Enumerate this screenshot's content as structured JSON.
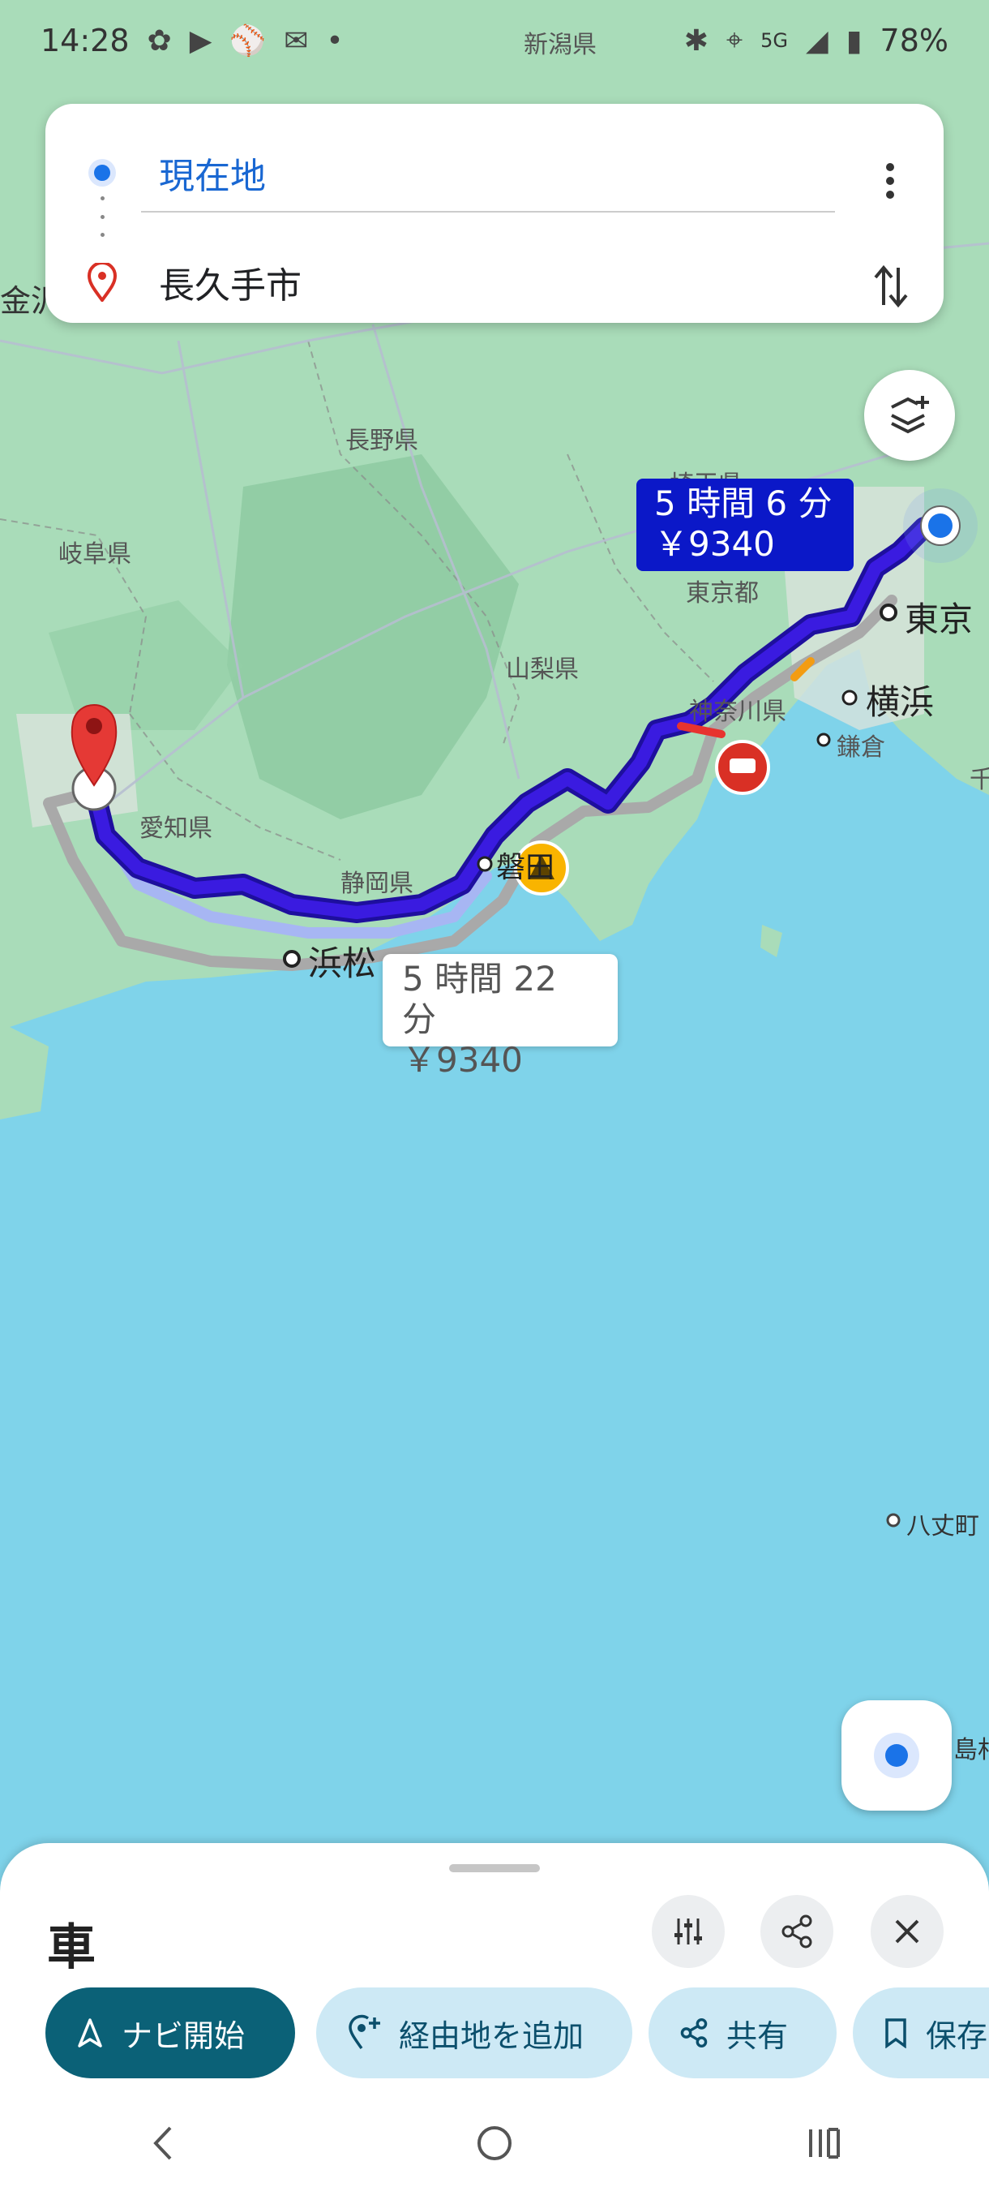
{
  "status_bar": {
    "time": "14:28",
    "network": "5G",
    "battery": "78%"
  },
  "search": {
    "origin": "現在地",
    "destination": "長久手市"
  },
  "map": {
    "route_main": {
      "duration": "5 時間 6 分",
      "toll": "￥9340"
    },
    "route_alt": {
      "duration": "5 時間 22 分",
      "toll": "￥9340"
    },
    "places": {
      "niigata": "新潟県",
      "kanazawa": "金沢",
      "nagano": "長野県",
      "gifu": "岐阜県",
      "saitama": "埼玉県",
      "tokyo_to": "東京都",
      "tokyo": "東京",
      "yamanashi": "山梨県",
      "kanagawa": "神奈川県",
      "yokohama": "横浜",
      "kamakura": "鎌倉",
      "chiba": "千",
      "aichi": "愛知県",
      "shizuoka": "静岡県",
      "hamamatsu": "浜松",
      "iwata": "磐田",
      "hachijo": "八丈町",
      "island": "島村"
    }
  },
  "sheet": {
    "mode": "車",
    "chips": {
      "start": "ナビ開始",
      "add_stop": "経由地を追加",
      "share": "共有",
      "save": "保存"
    }
  },
  "colors": {
    "route_primary": "#3a1be0",
    "route_alt": "#a9a9a9",
    "chip_primary": "#0b6177",
    "chip_secondary": "#cde9f5",
    "water": "#7fd3ea",
    "land": "#a9dcb9"
  }
}
